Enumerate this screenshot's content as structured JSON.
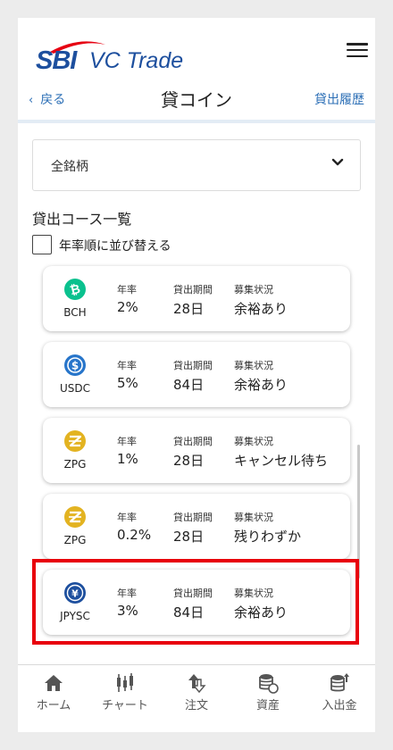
{
  "header": {
    "logo_text": "SBI VC Trade",
    "back_label": "戻る",
    "title": "貸コイン",
    "history_label": "貸出履歴"
  },
  "filter": {
    "selected": "全銘柄"
  },
  "courses": {
    "section_title": "貸出コース一覧",
    "sort_label": "年率順に並び替える",
    "sort_checked": false,
    "column_labels": {
      "rate": "年率",
      "period": "貸出期間",
      "status": "募集状況"
    },
    "items": [
      {
        "symbol": "BCH",
        "icon": "bitcoin-cash-icon",
        "rate": "2%",
        "period": "28日",
        "status": "余裕あり",
        "color": "#0ac18e"
      },
      {
        "symbol": "USDC",
        "icon": "usdc-icon",
        "rate": "5%",
        "period": "84日",
        "status": "余裕あり",
        "color": "#2775ca"
      },
      {
        "symbol": "ZPG",
        "icon": "zpg-icon",
        "rate": "1%",
        "period": "28日",
        "status": "キャンセル待ち",
        "color": "#e3b321"
      },
      {
        "symbol": "ZPG",
        "icon": "zpg-icon",
        "rate": "0.2%",
        "period": "28日",
        "status": "残りわずか",
        "color": "#e3b321"
      },
      {
        "symbol": "JPYSC",
        "icon": "jpysc-icon",
        "rate": "3%",
        "period": "84日",
        "status": "余裕あり",
        "color": "#1d4f9e",
        "highlighted": true
      }
    ]
  },
  "bottom_nav": [
    {
      "label": "ホーム",
      "icon": "home-icon"
    },
    {
      "label": "チャート",
      "icon": "chart-icon"
    },
    {
      "label": "注文",
      "icon": "order-icon"
    },
    {
      "label": "資産",
      "icon": "assets-icon"
    },
    {
      "label": "入出金",
      "icon": "deposit-withdraw-icon"
    }
  ],
  "colors": {
    "brand": "#1d4f9e",
    "link": "#2c6fb6",
    "highlight": "#e8000b"
  }
}
